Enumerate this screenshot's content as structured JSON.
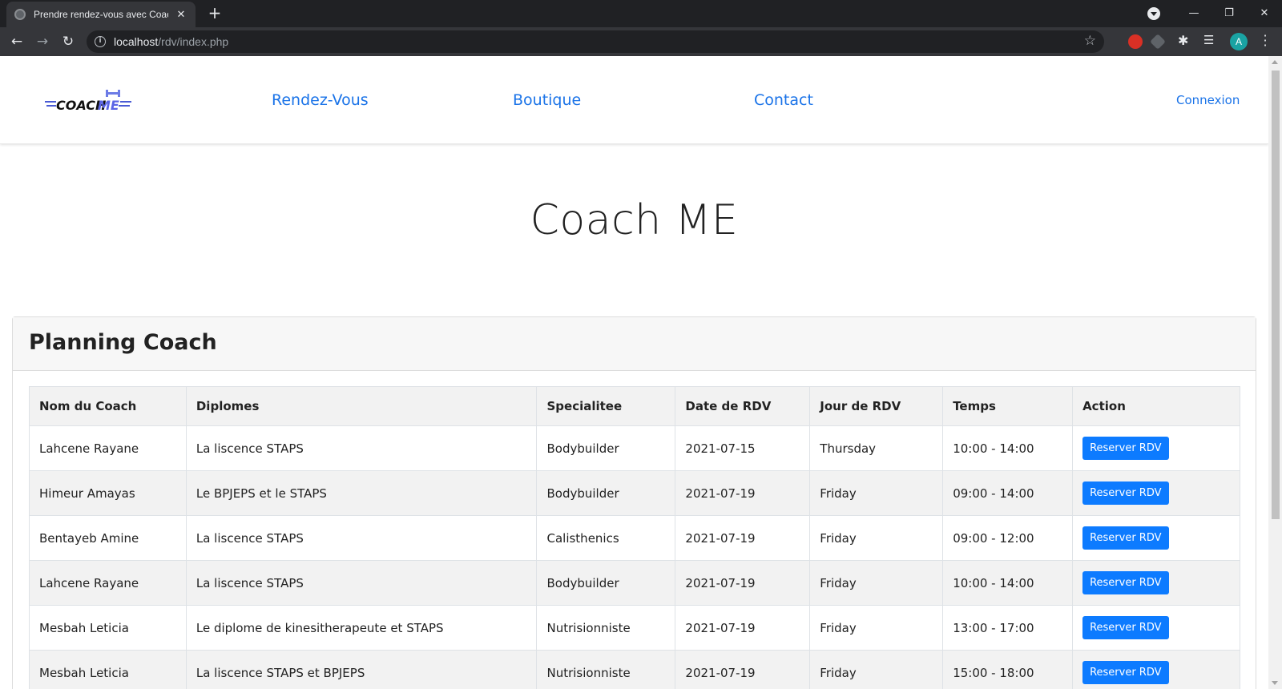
{
  "browser": {
    "tab_title": "Prendre rendez-vous avec Coach",
    "url_host": "localhost",
    "url_path": "/rdv/index.php",
    "avatar_letter": "A"
  },
  "header": {
    "logo_text_1": "COACH",
    "logo_text_2": "ME",
    "nav": [
      "Rendez-Vous",
      "Boutique",
      "Contact"
    ],
    "login": "Connexion"
  },
  "hero": {
    "title": "Coach ME"
  },
  "planning": {
    "title": "Planning Coach",
    "columns": [
      "Nom du Coach",
      "Diplomes",
      "Specialitee",
      "Date de RDV",
      "Jour de RDV",
      "Temps",
      "Action"
    ],
    "action_label": "Reserver RDV",
    "rows": [
      [
        "Lahcene Rayane",
        "La liscence STAPS",
        "Bodybuilder",
        "2021-07-15",
        "Thursday",
        "10:00 - 14:00"
      ],
      [
        "Himeur Amayas",
        "Le BPJEPS et le STAPS",
        "Bodybuilder",
        "2021-07-19",
        "Friday",
        "09:00 - 14:00"
      ],
      [
        "Bentayeb Amine",
        "La liscence STAPS",
        "Calisthenics",
        "2021-07-19",
        "Friday",
        "09:00 - 12:00"
      ],
      [
        "Lahcene Rayane",
        "La liscence STAPS",
        "Bodybuilder",
        "2021-07-19",
        "Friday",
        "10:00 - 14:00"
      ],
      [
        "Mesbah Leticia",
        "Le diplome de kinesitherapeute et STAPS",
        "Nutrisionniste",
        "2021-07-19",
        "Friday",
        "13:00 - 17:00"
      ],
      [
        "Mesbah Leticia",
        "La liscence STAPS et BPJEPS",
        "Nutrisionniste",
        "2021-07-19",
        "Friday",
        "15:00 - 18:00"
      ]
    ]
  },
  "colors": {
    "accent": "#1a73e8",
    "button": "#0d7bff"
  }
}
